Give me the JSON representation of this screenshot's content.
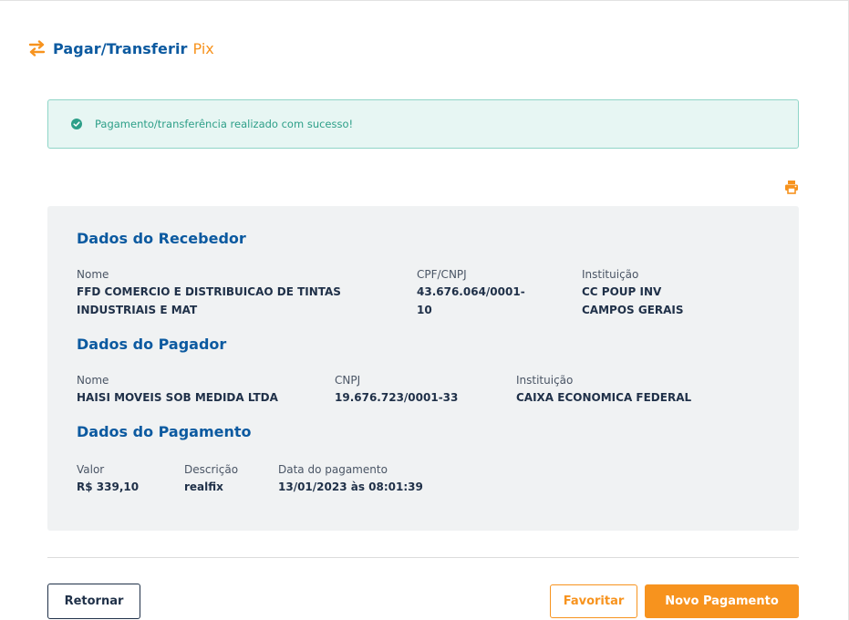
{
  "header": {
    "title": "Pagar/Transferir",
    "subtitle": "Pix"
  },
  "alert": {
    "message": "Pagamento/transferência realizado com sucesso!"
  },
  "receiver": {
    "section_title": "Dados do Recebedor",
    "name_label": "Nome",
    "name_line1": "FFD COMERCIO E DISTRIBUICAO DE TINTAS",
    "name_line2": "INDUSTRIAIS E MAT",
    "doc_label": "CPF/CNPJ",
    "doc_line1": "43.676.064/0001-",
    "doc_line2": "10",
    "inst_label": "Instituição",
    "inst_line1": "CC POUP INV",
    "inst_line2": "CAMPOS GERAIS"
  },
  "payer": {
    "section_title": "Dados do Pagador",
    "name_label": "Nome",
    "name_value": "HAISI MOVEIS SOB MEDIDA LTDA",
    "doc_label": "CNPJ",
    "doc_value": "19.676.723/0001-33",
    "inst_label": "Instituição",
    "inst_value": "CAIXA ECONOMICA FEDERAL"
  },
  "payment": {
    "section_title": "Dados do Pagamento",
    "value_label": "Valor",
    "value_value": "R$ 339,10",
    "desc_label": "Descrição",
    "desc_value": "realfix",
    "date_label": "Data do pagamento",
    "date_value": "13/01/2023 às 08:01:39"
  },
  "buttons": {
    "return_label": "Retornar",
    "favorite_label": "Favoritar",
    "new_payment_label": "Novo Pagamento"
  },
  "colors": {
    "brand_blue": "#0c5aa0",
    "accent_orange": "#f7931e",
    "success_green": "#2d9f88"
  },
  "icons": {
    "header": "swap-arrows-icon",
    "alert": "check-circle-icon",
    "print": "printer-icon"
  }
}
